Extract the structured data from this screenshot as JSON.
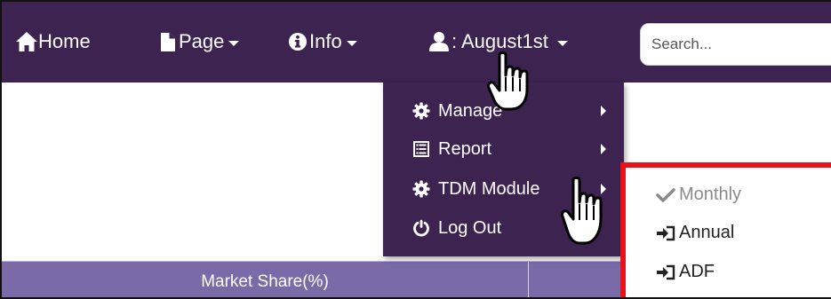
{
  "navbar": {
    "home_label": "Home",
    "page_label": "Page",
    "info_label": "Info",
    "user_label": ": August1st",
    "search_placeholder": "Search...",
    "home_icon": "home-icon",
    "page_icon": "file-icon",
    "info_icon": "info-circle-icon",
    "user_icon": "user-icon"
  },
  "user_menu": {
    "items": [
      {
        "label": "Manage",
        "icon": "gear-icon",
        "has_submenu": true
      },
      {
        "label": "Report",
        "icon": "list-alt-icon",
        "has_submenu": true
      },
      {
        "label": "TDM Module",
        "icon": "gear-icon",
        "has_submenu": true
      },
      {
        "label": "Log Out",
        "icon": "power-icon",
        "has_submenu": false
      }
    ]
  },
  "tdm_submenu": {
    "items": [
      {
        "label": "Monthly",
        "icon": "check-icon",
        "state": "selected"
      },
      {
        "label": "Annual",
        "icon": "sign-in-icon"
      },
      {
        "label": "ADF",
        "icon": "sign-in-icon"
      }
    ],
    "highlight_color": "#e8131a"
  },
  "table": {
    "columns": [
      "Market Share(%)"
    ]
  },
  "colors": {
    "navbar_bg": "#3c2350",
    "table_header_bg": "#7a6aa8",
    "highlight_border": "#e8131a"
  },
  "cursors": [
    "hand-pointer-icon",
    "hand-pointer-icon"
  ]
}
